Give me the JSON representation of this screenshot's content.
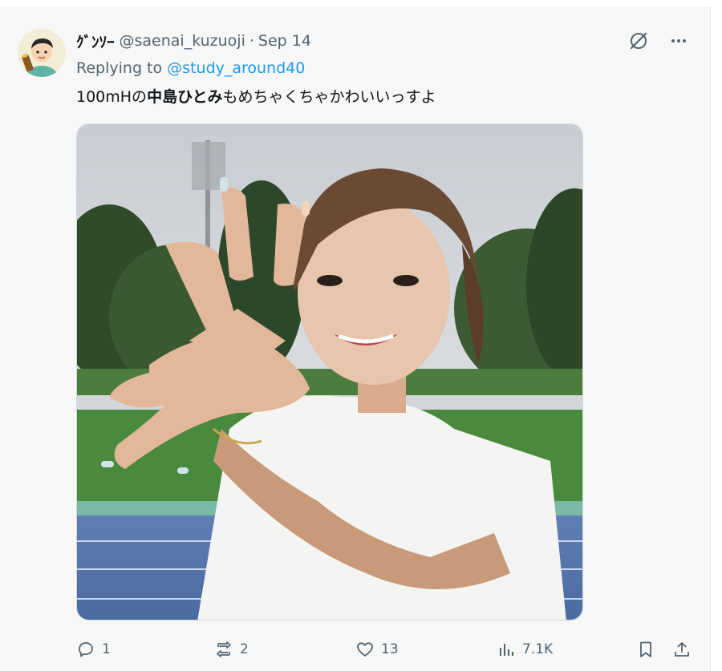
{
  "tweet": {
    "display_name": "ｸﾞﾝｿｰ",
    "handle": "@saenai_kuzuoji",
    "separator": "·",
    "date": "Sep 14",
    "replying_prefix": "Replying to",
    "replying_to": "@study_around40",
    "text_before": "100mHの",
    "text_bold": "中島ひとみ",
    "text_after": "もめちゃくちゃかわいいっすよ"
  },
  "icons": {
    "avatar": "user-avatar",
    "grok": "grok-icon",
    "more": "more-icon",
    "reply": "reply-icon",
    "retweet": "retweet-icon",
    "like": "heart-icon",
    "views": "views-icon",
    "bookmark": "bookmark-icon",
    "share": "share-icon"
  },
  "actions": {
    "replies": "1",
    "retweets": "2",
    "likes": "13",
    "views": "7.1K"
  },
  "colors": {
    "link": "#1d9bf0",
    "secondary_text": "#536471",
    "background": "#f7f7f7"
  }
}
